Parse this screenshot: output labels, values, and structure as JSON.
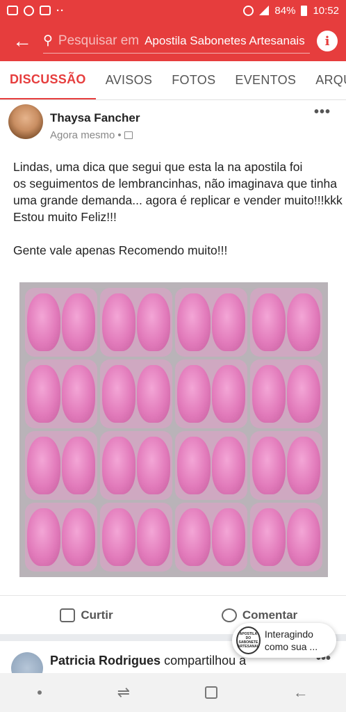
{
  "status_bar": {
    "battery": "84%",
    "time": "10:52",
    "overflow": "··"
  },
  "search": {
    "placeholder": "Pesquisar em",
    "group_name": "Apostila Sabonetes Artesanais",
    "info_icon": "i",
    "back_icon": "arrow-left-icon"
  },
  "tabs": [
    "DISCUSSÃO",
    "AVISOS",
    "FOTOS",
    "EVENTOS",
    "ARQUIV"
  ],
  "post": {
    "author": "Thaysa Fancher",
    "timestamp": "Agora mesmo",
    "separator": "•",
    "more": "•••",
    "body": [
      "Lindas, uma dica que segui que esta la na apostila foi",
      "os seguimentos de lembrancinhas, não imaginava que tinha",
      "uma grande demanda... agora é replicar e vender muito!!!kkk",
      "Estou muito Feliz!!!",
      "",
      "Gente vale apenas Recomendo muito!!!"
    ],
    "like_label": "Curtir",
    "comment_label": "Comentar"
  },
  "next_post": {
    "author": "Patricia Rodrigues",
    "action": "compartilhou a",
    "more": "•••"
  },
  "chat_head": {
    "logo_text": "APOSTILA DO SABONETE ARTESANAL",
    "text": "Interagindo como sua ..."
  },
  "colors": {
    "accent": "#e63d3d",
    "soap_pink": "#e27bbb"
  }
}
